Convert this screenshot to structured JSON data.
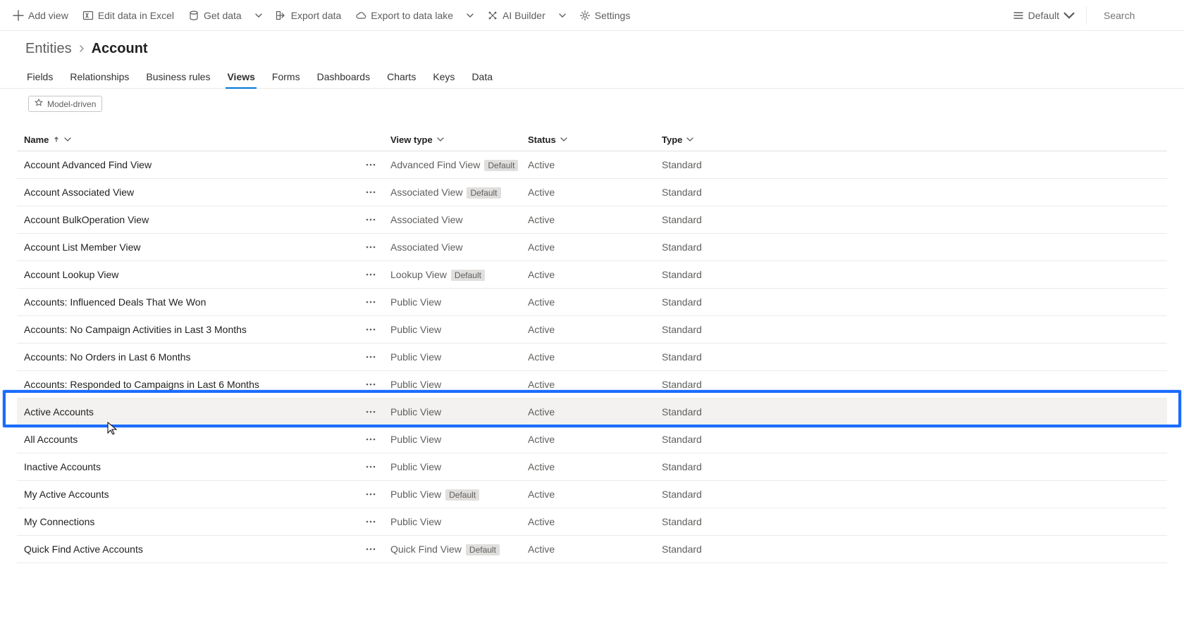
{
  "commandbar": {
    "add_view": "Add view",
    "edit_excel": "Edit data in Excel",
    "get_data": "Get data",
    "export_data": "Export data",
    "export_lake": "Export to data lake",
    "ai_builder": "AI Builder",
    "settings": "Settings",
    "default_label": "Default",
    "search_placeholder": "Search"
  },
  "breadcrumb": {
    "parent": "Entities",
    "current": "Account"
  },
  "tabs": {
    "fields": "Fields",
    "relationships": "Relationships",
    "business_rules": "Business rules",
    "views": "Views",
    "forms": "Forms",
    "dashboards": "Dashboards",
    "charts": "Charts",
    "keys": "Keys",
    "data": "Data"
  },
  "filter_pill": "Model-driven",
  "columns": {
    "name": "Name",
    "view_type": "View type",
    "status": "Status",
    "type": "Type"
  },
  "default_badge": "Default",
  "rows": [
    {
      "name": "Account Advanced Find View",
      "view_type": "Advanced Find View",
      "default": true,
      "status": "Active",
      "type": "Standard"
    },
    {
      "name": "Account Associated View",
      "view_type": "Associated View",
      "default": true,
      "status": "Active",
      "type": "Standard"
    },
    {
      "name": "Account BulkOperation View",
      "view_type": "Associated View",
      "default": false,
      "status": "Active",
      "type": "Standard"
    },
    {
      "name": "Account List Member View",
      "view_type": "Associated View",
      "default": false,
      "status": "Active",
      "type": "Standard"
    },
    {
      "name": "Account Lookup View",
      "view_type": "Lookup View",
      "default": true,
      "status": "Active",
      "type": "Standard"
    },
    {
      "name": "Accounts: Influenced Deals That We Won",
      "view_type": "Public View",
      "default": false,
      "status": "Active",
      "type": "Standard"
    },
    {
      "name": "Accounts: No Campaign Activities in Last 3 Months",
      "view_type": "Public View",
      "default": false,
      "status": "Active",
      "type": "Standard"
    },
    {
      "name": "Accounts: No Orders in Last 6 Months",
      "view_type": "Public View",
      "default": false,
      "status": "Active",
      "type": "Standard"
    },
    {
      "name": "Accounts: Responded to Campaigns in Last 6 Months",
      "view_type": "Public View",
      "default": false,
      "status": "Active",
      "type": "Standard"
    },
    {
      "name": "Active Accounts",
      "view_type": "Public View",
      "default": false,
      "status": "Active",
      "type": "Standard",
      "highlight": true
    },
    {
      "name": "All Accounts",
      "view_type": "Public View",
      "default": false,
      "status": "Active",
      "type": "Standard"
    },
    {
      "name": "Inactive Accounts",
      "view_type": "Public View",
      "default": false,
      "status": "Active",
      "type": "Standard"
    },
    {
      "name": "My Active Accounts",
      "view_type": "Public View",
      "default": true,
      "status": "Active",
      "type": "Standard"
    },
    {
      "name": "My Connections",
      "view_type": "Public View",
      "default": false,
      "status": "Active",
      "type": "Standard"
    },
    {
      "name": "Quick Find Active Accounts",
      "view_type": "Quick Find View",
      "default": true,
      "status": "Active",
      "type": "Standard"
    }
  ]
}
